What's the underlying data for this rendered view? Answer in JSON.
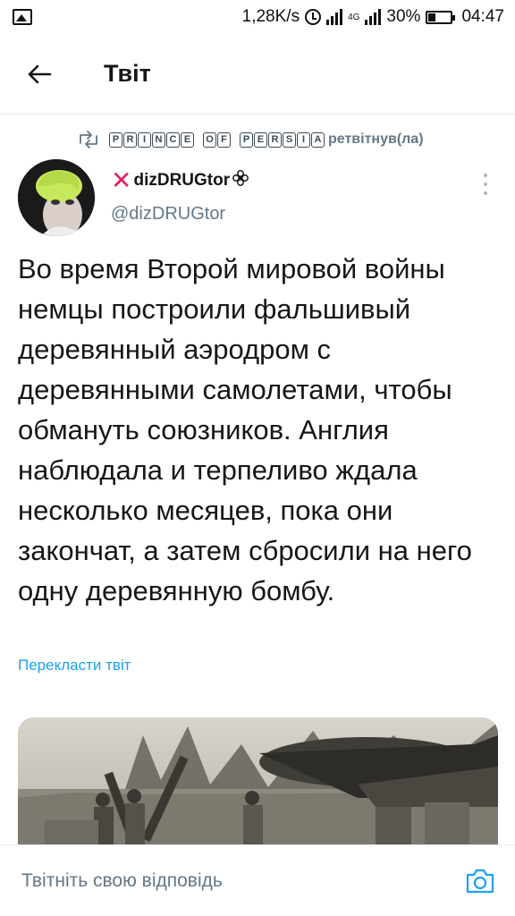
{
  "status_bar": {
    "speed": "1,28K/s",
    "network": "4G",
    "battery": "30%",
    "time": "04:47"
  },
  "header": {
    "title": "Твіт"
  },
  "retweet": {
    "by_name": "PRINCE OF PERSIA",
    "label": "ретвітнув(ла)"
  },
  "tweet": {
    "author_name": "dizDRUGtor",
    "author_prefix_icon": "red-x-icon",
    "author_suffix_icon": "flower-icon",
    "handle": "@dizDRUGtor",
    "text": "Во время Второй мировой войны немцы построили фальшивый деревянный аэродром с деревянными самолетами, чтобы обмануть союзников. Англия наблюдала и терпеливо ждала несколько месяцев, пока они закончат, а затем сбросили на него одну деревянную бомбу.",
    "translate_link": "Перекласти твіт"
  },
  "reply": {
    "placeholder": "Твітніть свою відповідь"
  },
  "colors": {
    "accent": "#1da1f2",
    "secondary_text": "#657786",
    "x_mark": "#e0245e"
  }
}
